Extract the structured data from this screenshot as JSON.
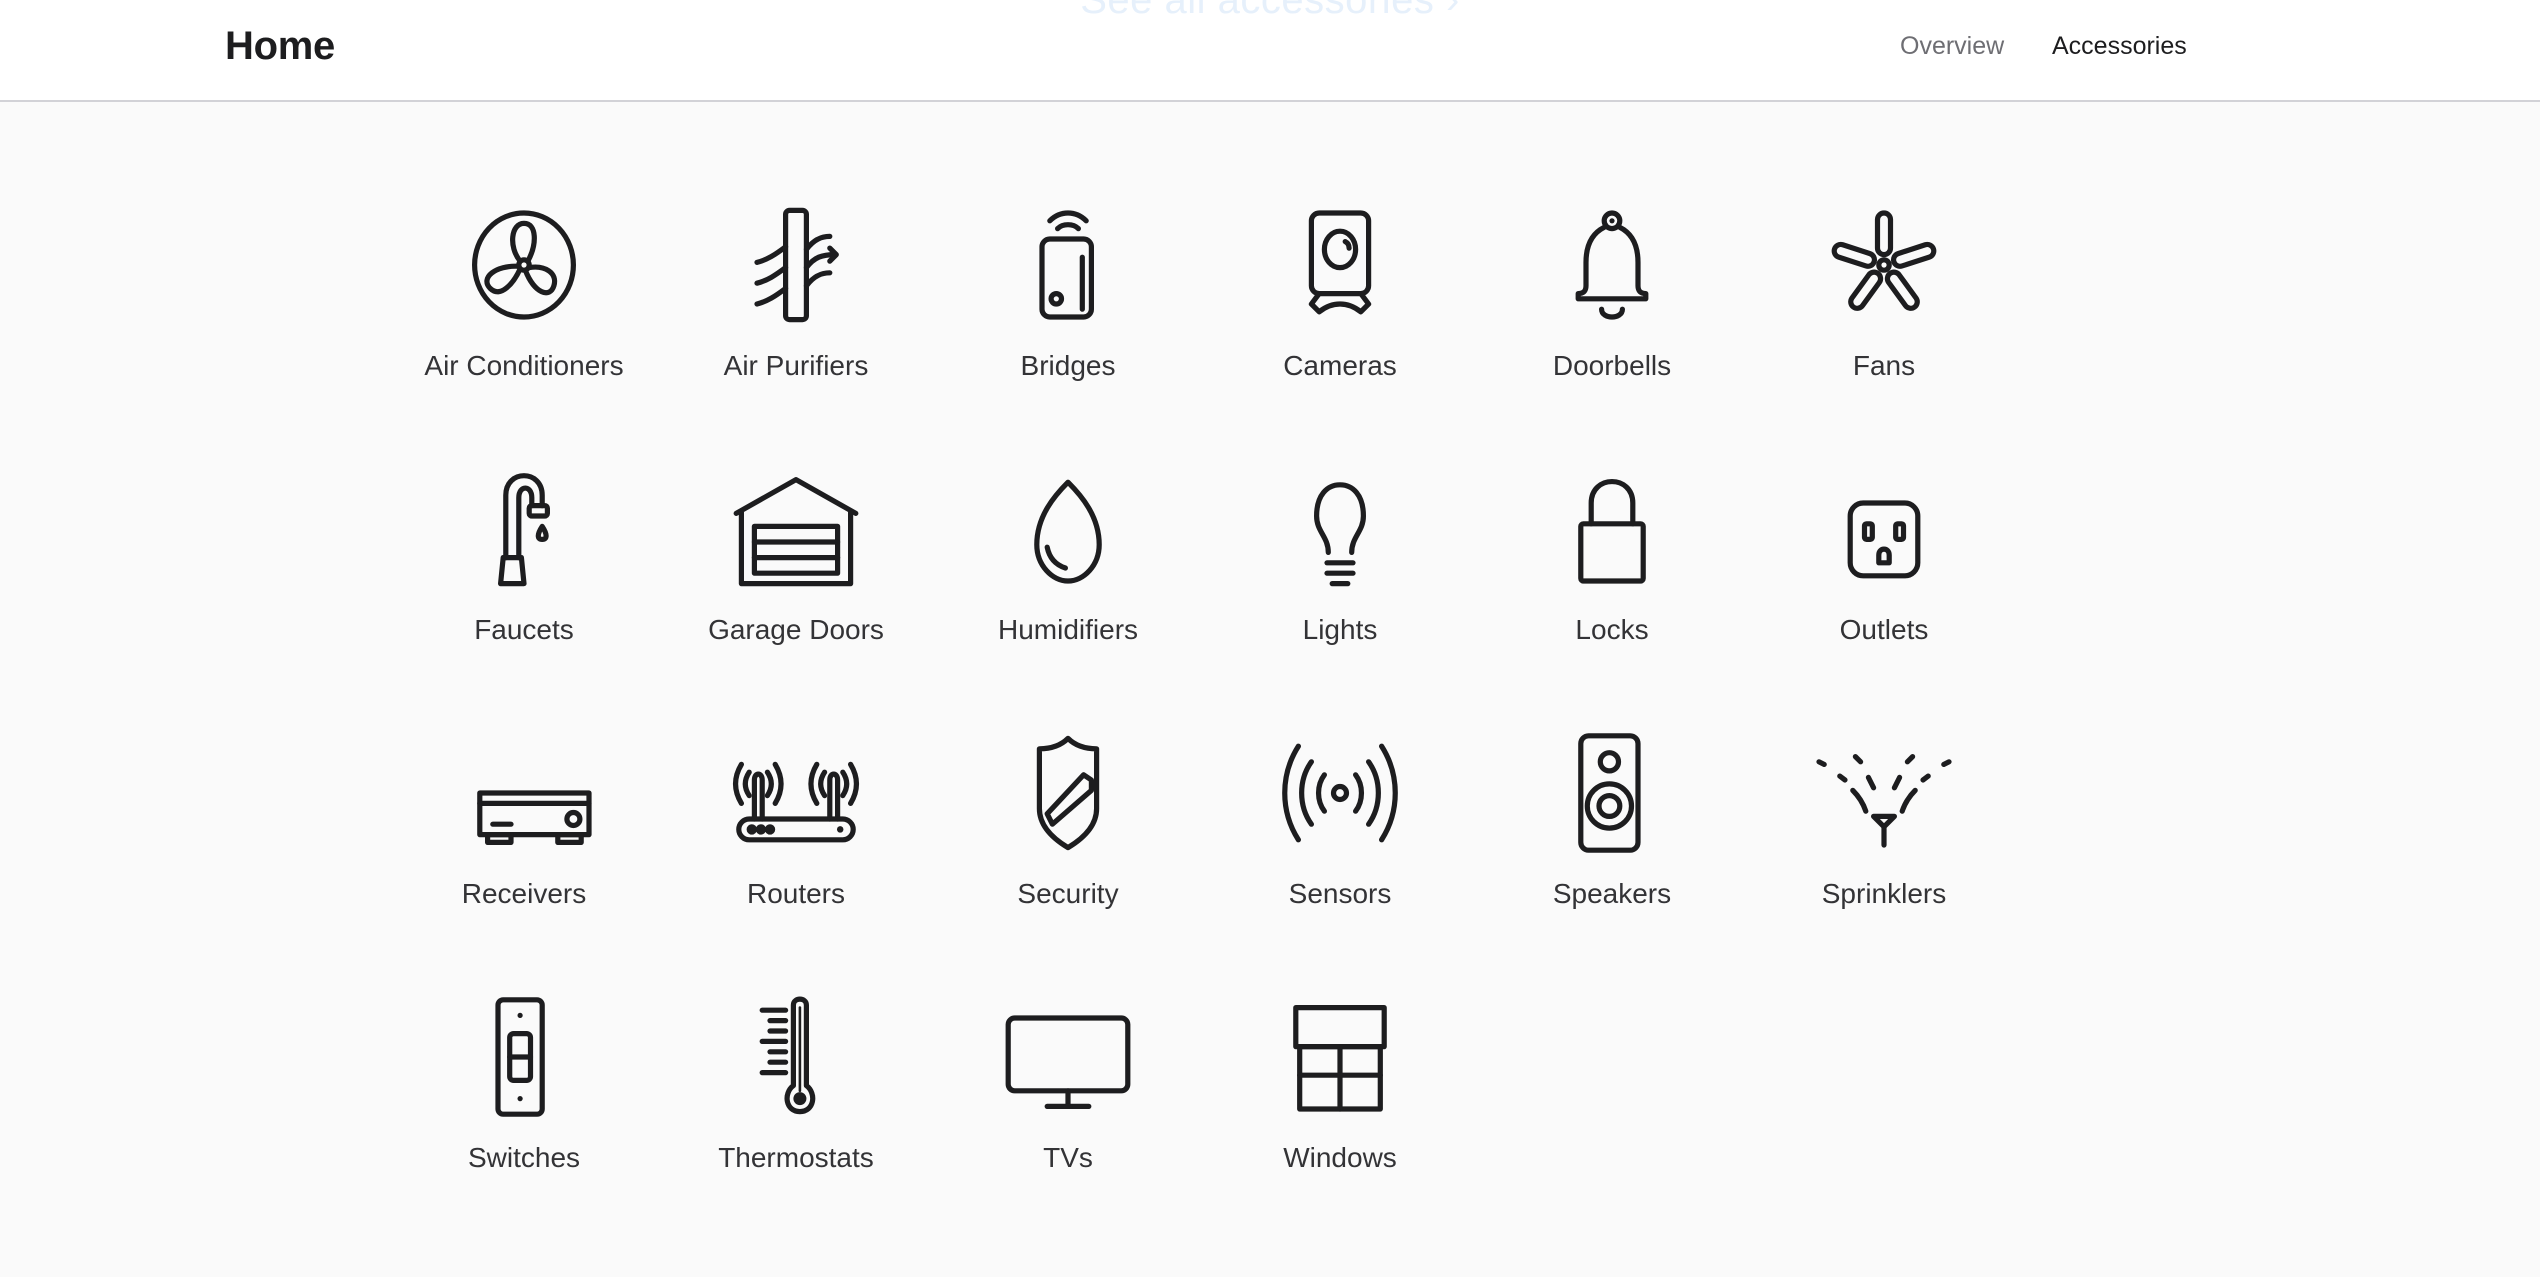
{
  "promo": {
    "see_all_label": "See all accessories ›"
  },
  "header": {
    "title": "Home",
    "nav": [
      {
        "label": "Overview",
        "active": false
      },
      {
        "label": "Accessories",
        "active": true
      }
    ]
  },
  "colors": {
    "background": "#fafafa",
    "header_background": "#ffffff",
    "text_primary": "#1d1d1f",
    "text_secondary": "#6e6e73",
    "link_faded": "#e6f0fb"
  },
  "categories": [
    {
      "label": "Air Conditioners",
      "icon": "air-conditioner-icon"
    },
    {
      "label": "Air Purifiers",
      "icon": "air-purifier-icon"
    },
    {
      "label": "Bridges",
      "icon": "bridge-icon"
    },
    {
      "label": "Cameras",
      "icon": "camera-icon"
    },
    {
      "label": "Doorbells",
      "icon": "doorbell-icon"
    },
    {
      "label": "Fans",
      "icon": "fan-icon"
    },
    {
      "label": "Faucets",
      "icon": "faucet-icon"
    },
    {
      "label": "Garage Doors",
      "icon": "garage-door-icon"
    },
    {
      "label": "Humidifiers",
      "icon": "humidifier-icon"
    },
    {
      "label": "Lights",
      "icon": "light-bulb-icon"
    },
    {
      "label": "Locks",
      "icon": "lock-icon"
    },
    {
      "label": "Outlets",
      "icon": "outlet-icon"
    },
    {
      "label": "Receivers",
      "icon": "receiver-icon"
    },
    {
      "label": "Routers",
      "icon": "router-icon"
    },
    {
      "label": "Security",
      "icon": "security-shield-icon"
    },
    {
      "label": "Sensors",
      "icon": "sensor-icon"
    },
    {
      "label": "Speakers",
      "icon": "speaker-icon"
    },
    {
      "label": "Sprinklers",
      "icon": "sprinkler-icon"
    },
    {
      "label": "Switches",
      "icon": "switch-icon"
    },
    {
      "label": "Thermostats",
      "icon": "thermostat-icon"
    },
    {
      "label": "TVs",
      "icon": "tv-icon"
    },
    {
      "label": "Windows",
      "icon": "window-icon"
    }
  ]
}
